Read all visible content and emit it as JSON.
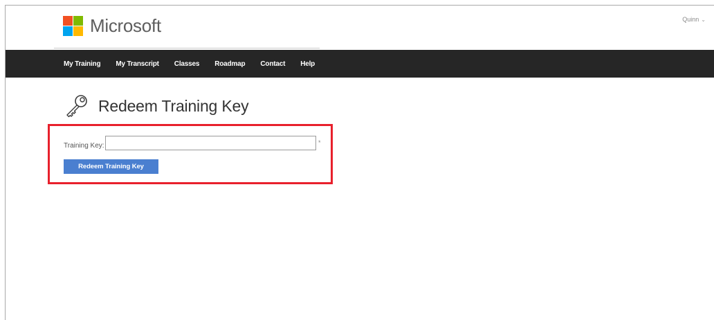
{
  "header": {
    "brand": "Microsoft",
    "logo_colors": [
      "#f25022",
      "#7fba00",
      "#00a4ef",
      "#ffb900"
    ],
    "user_name": "Quinn",
    "user_chevron_icon": "chevron-down-icon"
  },
  "nav": {
    "items": [
      {
        "label": "My Training"
      },
      {
        "label": "My Transcript"
      },
      {
        "label": "Classes"
      },
      {
        "label": "Roadmap"
      },
      {
        "label": "Contact"
      },
      {
        "label": "Help"
      }
    ],
    "background": "#262626"
  },
  "page": {
    "title": "Redeem Training Key",
    "title_icon": "key-icon"
  },
  "form": {
    "field_label": "Training Key:",
    "field_value": "",
    "required_mark": "*",
    "submit_label": "Redeem Training Key",
    "submit_color": "#4a7fd0",
    "highlight_color": "#e8202c"
  }
}
